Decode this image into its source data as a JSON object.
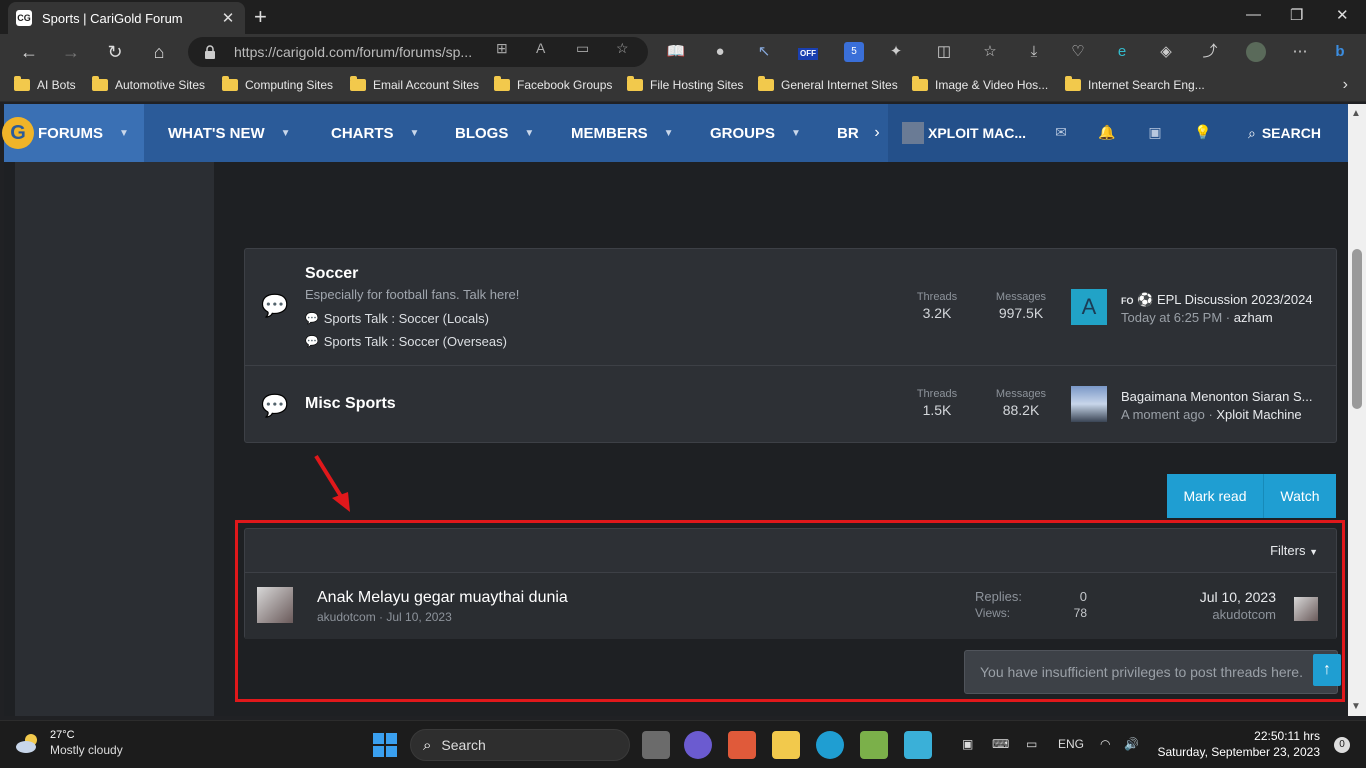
{
  "browser": {
    "tab_title": "Sports | CariGold Forum",
    "tab_favicon": "CG",
    "url": "https://carigold.com/forum/forums/sp...",
    "bookmarks": [
      {
        "label": "AI Bots",
        "icon": "folder-icon"
      },
      {
        "label": "Automotive Sites",
        "icon": "folder-icon"
      },
      {
        "label": "Computing Sites",
        "icon": "folder-icon"
      },
      {
        "label": "Email Account Sites",
        "icon": "folder-icon"
      },
      {
        "label": "Facebook Groups",
        "icon": "folder-icon"
      },
      {
        "label": "File Hosting Sites",
        "icon": "folder-icon"
      },
      {
        "label": "General Internet Sites",
        "icon": "folder-icon"
      },
      {
        "label": "Image & Video Hos...",
        "icon": "folder-icon"
      },
      {
        "label": "Internet Search Eng...",
        "icon": "folder-icon"
      }
    ],
    "ext_badge_off": "OFF",
    "ext_badge_count": "5"
  },
  "sitenav": {
    "items": [
      {
        "label": "FORUMS"
      },
      {
        "label": "WHAT'S NEW"
      },
      {
        "label": "CHARTS"
      },
      {
        "label": "BLOGS"
      },
      {
        "label": "MEMBERS"
      },
      {
        "label": "GROUPS"
      },
      {
        "label": "BR"
      }
    ],
    "user": "XPLOIT MAC...",
    "search": "SEARCH"
  },
  "nodes": [
    {
      "title": "Soccer",
      "description": "Especially for football fans. Talk here!",
      "subforums": [
        "Sports Talk : Soccer (Locals)",
        "Sports Talk : Soccer (Overseas)"
      ],
      "threads_label": "Threads",
      "threads": "3.2K",
      "messages_label": "Messages",
      "messages": "997.5K",
      "last_avatar_letter": "A",
      "last_prefix": "FO",
      "last_title": "EPL Discussion 2023/2024",
      "last_time": "Today at 6:25 PM",
      "last_user": "azham"
    },
    {
      "title": "Misc Sports",
      "threads_label": "Threads",
      "threads": "1.5K",
      "messages_label": "Messages",
      "messages": "88.2K",
      "last_title": "Bagaimana Menonton Siaran S...",
      "last_time": "A moment ago",
      "last_user": "Xploit Machine"
    }
  ],
  "actions": {
    "mark_read": "Mark read",
    "watch": "Watch"
  },
  "threadlist": {
    "filters": "Filters",
    "thread": {
      "title": "Anak Melayu gegar muaythai dunia",
      "author": "akudotcom",
      "date": "Jul 10, 2023",
      "replies_label": "Replies:",
      "replies": "0",
      "views_label": "Views:",
      "views": "78",
      "last_date": "Jul 10, 2023",
      "last_user": "akudotcom"
    }
  },
  "no_privileges": "You have insufficient privileges to post threads here.",
  "taskbar": {
    "temp": "27°C",
    "condition": "Mostly cloudy",
    "search": "Search",
    "lang": "ENG",
    "time": "22:50:11 hrs",
    "date": "Saturday, September 23, 2023",
    "notifications": "0"
  },
  "colors": {
    "nav_blue": "#2b5b99",
    "accent_button": "#1f9ed2",
    "highlight_red": "#e0181b",
    "page_bg": "#1e2023",
    "panel_bg": "#2d3035"
  }
}
